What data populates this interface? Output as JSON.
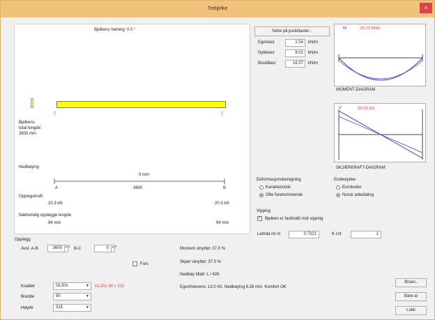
{
  "window": {
    "title": "Trebjelke",
    "close_glyph": "×"
  },
  "beam": {
    "inclination": "Bjelkens helning: 0.0 °",
    "left_label": "Bjelkens\ntotal lengde:\n3600 mm",
    "deflection_label": "Nedbøying",
    "deflection_value": "0 mm",
    "support_a": "A",
    "support_b": "B",
    "span": "3600",
    "support_force_label": "Opplegskraft",
    "force_a": "20.3 kN",
    "force_b": "20.3 kN",
    "support_length_label": "Nødvendig opplegge lengde",
    "len_a": "94 mm",
    "len_b": "94 mm"
  },
  "loads": {
    "set_button": "Sette på punktlaster...",
    "rows": [
      {
        "label": "Egenlast",
        "value": "2.54",
        "unit": "kN/m"
      },
      {
        "label": "Nyttelast",
        "value": "8.01",
        "unit": "kN/m"
      },
      {
        "label": "Bruddlast",
        "value": "16.07",
        "unit": "kN/m"
      }
    ]
  },
  "moment": {
    "axis_label": "M",
    "value": "26.23 kNm",
    "caption": "MOMENT-DIAGRAM",
    "color": "#3a3ad8"
  },
  "shear": {
    "axis_label": "V",
    "value": "29.00 kN",
    "caption": "SKJÆRKRAFT-DIAGRAM",
    "color": "#3a3ad8"
  },
  "deformation": {
    "heading": "Deformasjonsberegning",
    "options": [
      "Karakteristisk",
      "Ofte forekommende"
    ],
    "selected": 1
  },
  "end_conditions": {
    "heading": "Endestykke",
    "options": [
      "Eurokoder",
      "Norsk anbefaling"
    ],
    "selected": 1
  },
  "buckling": {
    "heading": "Vipping",
    "checkbox_label": "Bjelken er fastholdt mot vipping",
    "checked": true,
    "lambda_label": "Lamda rel m",
    "lambda_value": "0.7321",
    "k_label": "K crit",
    "k_value": "1"
  },
  "supports": {
    "heading": "Opplegg",
    "ab_label": "Avst. A-B",
    "ab_value": "3600",
    "bc_label": "B-C",
    "bc_value": "0",
    "fixed_label": "Fors"
  },
  "section": {
    "quality_label": "Kvalitet",
    "quality_value": "GL30c",
    "quality_note": "GL30c   98 x 315",
    "width_label": "Bredde",
    "width_value": "90",
    "height_label": "Høyde",
    "height_value": "315"
  },
  "results": {
    "moment_util": "Moment utnyttet:   37.0 %",
    "shear_util": "Skjær utnyttet:   37.0 %",
    "deflection": "Nedbøy tillatt:   L / 426",
    "frequency": "Egenfrekvens: 13.0 Hz, Nedbøying 6.28 mm, Komfort OK"
  },
  "buttons": {
    "browse": "Bruev..",
    "save": "Bare ai",
    "close": "Lukk"
  }
}
